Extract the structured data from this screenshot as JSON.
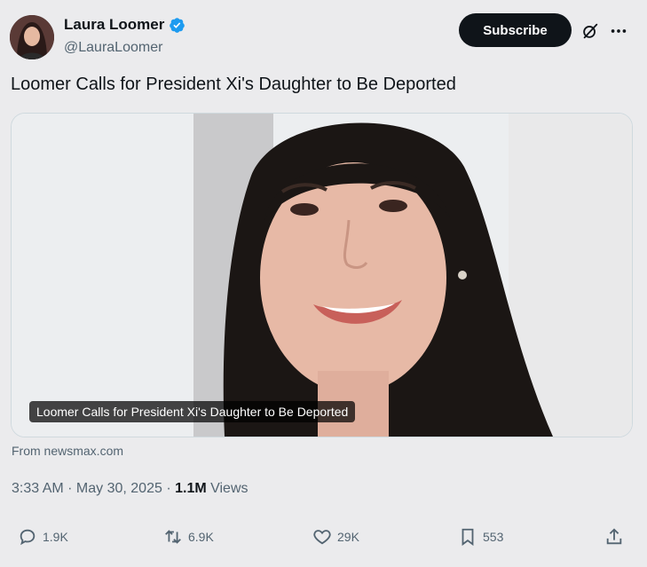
{
  "author": {
    "name": "Laura Loomer",
    "handle": "@LauraLoomer",
    "verified_icon": "verified-badge-icon"
  },
  "header": {
    "subscribe_label": "Subscribe",
    "grok_icon": "grok-icon",
    "more_icon": "more-icon"
  },
  "post": {
    "text": "Loomer Calls for President Xi's Daughter to Be Deported",
    "media_caption": "Loomer Calls for President Xi's Daughter to Be Deported",
    "source": "From newsmax.com"
  },
  "meta": {
    "time": "3:33 AM",
    "sep1": " · ",
    "date": "May 30, 2025",
    "sep2": " · ",
    "views_count": "1.1M",
    "views_label": " Views"
  },
  "actions": {
    "replies": "1.9K",
    "reposts": "6.9K",
    "likes": "29K",
    "bookmarks": "553"
  },
  "colors": {
    "background": "#ebebed",
    "text": "#0f1419",
    "secondary": "#536471",
    "verified": "#1d9bf0",
    "button": "#0f1419"
  }
}
